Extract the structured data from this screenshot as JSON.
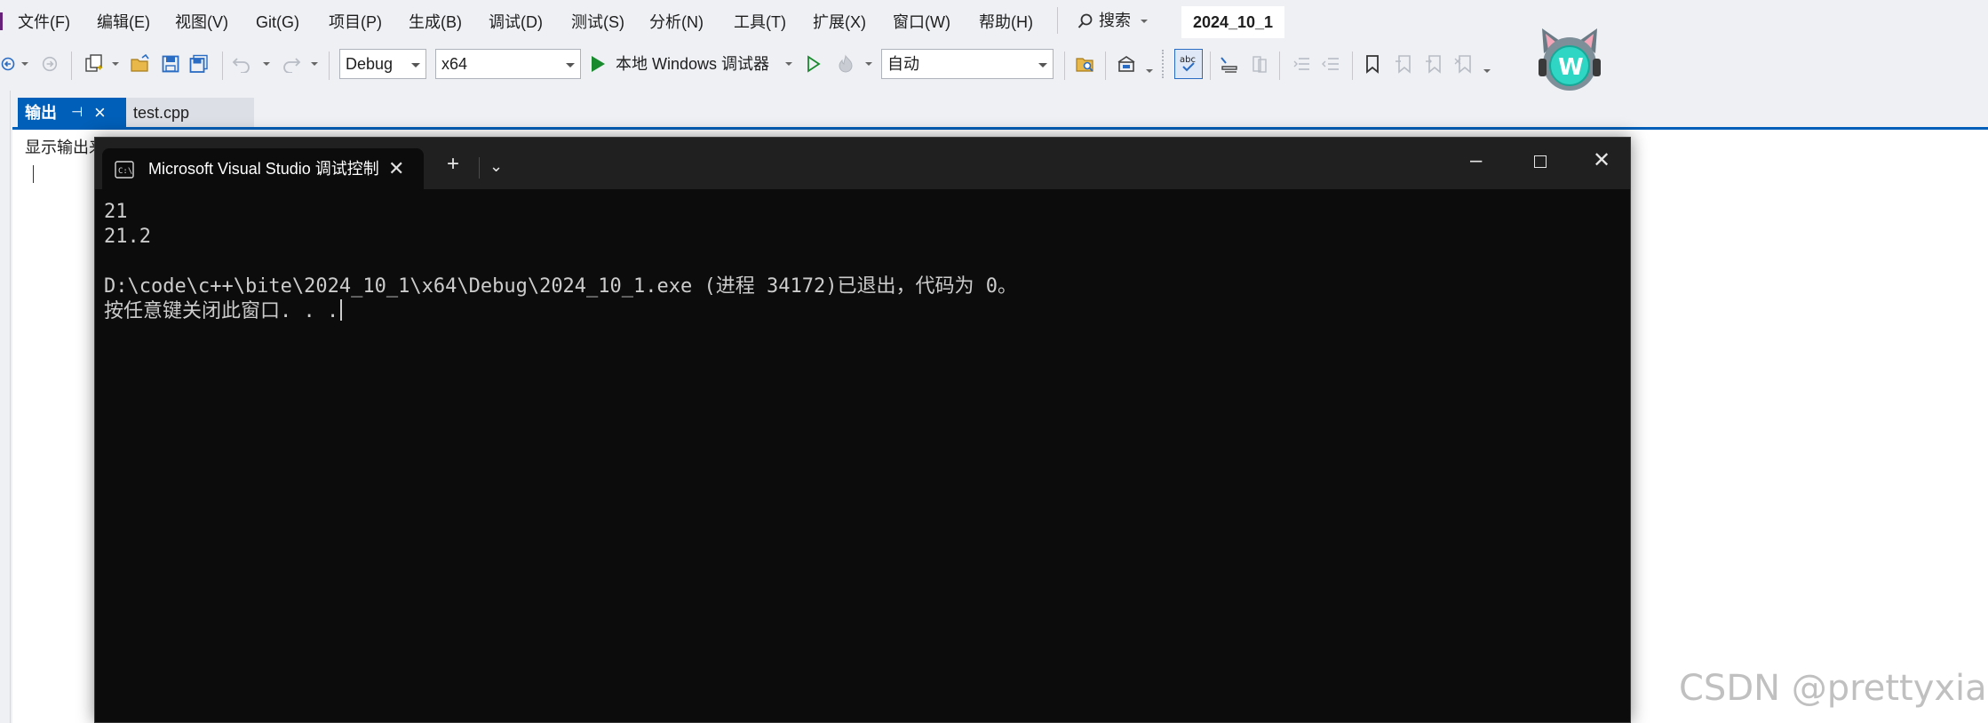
{
  "menubar": {
    "items": [
      "文件(F)",
      "编辑(E)",
      "视图(V)",
      "Git(G)",
      "项目(P)",
      "生成(B)",
      "调试(D)",
      "测试(S)",
      "分析(N)",
      "工具(T)",
      "扩展(X)",
      "窗口(W)",
      "帮助(H)"
    ],
    "search_label": "搜索",
    "solution_title": "2024_10_1"
  },
  "toolbar": {
    "configuration": "Debug",
    "platform": "x64",
    "start_debug_label": "本地 Windows 调试器",
    "stack_frame": "自动"
  },
  "output_panel": {
    "tabs": [
      "输出",
      "test.cpp"
    ],
    "output_source_label": "显示输出来"
  },
  "console": {
    "tab_title": "Microsoft Visual Studio 调试控制台",
    "lines": [
      "21",
      "21.2",
      "",
      "D:\\code\\c++\\bite\\2024_10_1\\x64\\Debug\\2024_10_1.exe (进程 34172)已退出，代码为 0。",
      "按任意键关闭此窗口. . ."
    ]
  },
  "watermark": "CSDN @prettyxian",
  "colors": {
    "accent": "#005fb8",
    "console_bg": "#0c0c0c",
    "console_text": "#cccccc",
    "run_green": "#1a8a2e"
  },
  "icons": [
    "back-icon",
    "forward-icon",
    "new-project-icon",
    "open-file-icon",
    "save-icon",
    "save-all-icon",
    "undo-icon",
    "redo-icon",
    "play-icon",
    "start-without-debug-icon",
    "hot-reload-icon",
    "find-in-files-icon",
    "toolbox-icon",
    "spell-check-icon",
    "comment-icon",
    "bookmark-icon",
    "search-icon",
    "avatar",
    "cmd-icon",
    "close-icon",
    "pin-icon",
    "plus-icon",
    "chevron-down-icon",
    "minimize-icon",
    "maximize-icon"
  ]
}
